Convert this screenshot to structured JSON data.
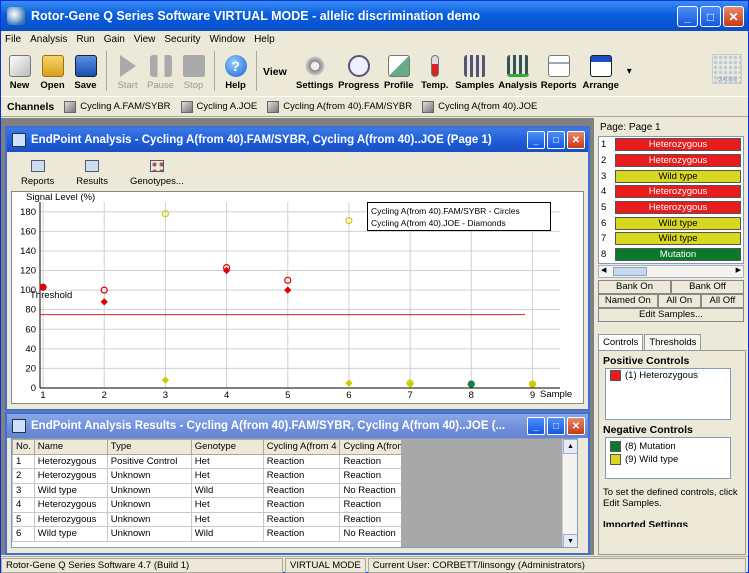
{
  "app": {
    "title": "Rotor-Gene Q Series Software VIRTUAL MODE - allelic discrimination demo"
  },
  "menu": [
    "File",
    "Analysis",
    "Run",
    "Gain",
    "View",
    "Security",
    "Window",
    "Help"
  ],
  "toolbar": {
    "left": [
      {
        "label": "New",
        "icon": "new-icon",
        "enabled": true
      },
      {
        "label": "Open",
        "icon": "open-folder-icon",
        "enabled": true
      },
      {
        "label": "Save",
        "icon": "save-disk-icon",
        "enabled": true
      },
      {
        "label": "Start",
        "icon": "play-icon",
        "enabled": false
      },
      {
        "label": "Pause",
        "icon": "pause-icon",
        "enabled": false
      },
      {
        "label": "Stop",
        "icon": "stop-icon",
        "enabled": false
      },
      {
        "label": "Help",
        "icon": "help-icon",
        "enabled": true
      }
    ],
    "view_label": "View",
    "view": [
      {
        "label": "Settings",
        "icon": "gears-icon"
      },
      {
        "label": "Progress",
        "icon": "stopwatch-icon"
      },
      {
        "label": "Profile",
        "icon": "profile-chart-icon"
      },
      {
        "label": "Temp.",
        "icon": "thermometer-icon"
      },
      {
        "label": "Samples",
        "icon": "samples-icon"
      },
      {
        "label": "Analysis",
        "icon": "analysis-icon"
      },
      {
        "label": "Reports",
        "icon": "reports-icon"
      },
      {
        "label": "Arrange",
        "icon": "arrange-windows-icon"
      }
    ],
    "brand": "QIAGEN"
  },
  "channels": {
    "label": "Channels",
    "items": [
      "Cycling A.FAM/SYBR",
      "Cycling A.JOE",
      "Cycling A(from 40).FAM/SYBR",
      "Cycling A(from 40).JOE"
    ]
  },
  "endpoint_window": {
    "title": "EndPoint Analysis - Cycling A(from 40).FAM/SYBR, Cycling A(from 40)..JOE (Page 1)",
    "tools": [
      "Reports",
      "Results",
      "Genotypes..."
    ],
    "legend": [
      "Cycling A(from 40).FAM/SYBR - Circles",
      "Cycling A(from 40).JOE - Diamonds"
    ],
    "threshold_label": "Threshold"
  },
  "chart_data": {
    "type": "scatter",
    "ylabel": "Signal Level (%)",
    "xlabel": "Sample",
    "x_ticks": [
      1,
      2,
      3,
      4,
      5,
      6,
      7,
      8,
      9
    ],
    "y_ticks": [
      0,
      20,
      40,
      60,
      80,
      100,
      120,
      140,
      160,
      180
    ],
    "xlim": [
      0.95,
      9.45
    ],
    "ylim": [
      0,
      190
    ],
    "threshold": 75,
    "grid": true,
    "legend": "top-right",
    "series": [
      {
        "name": "Cycling A(from 40).FAM/SYBR - Circles",
        "shape": "circle",
        "points": [
          [
            1,
            103,
            "#e00000"
          ],
          [
            2,
            100,
            "#e00000"
          ],
          [
            3,
            178,
            "#cccc00"
          ],
          [
            4,
            123,
            "#e00000"
          ],
          [
            5,
            110,
            "#e00000"
          ],
          [
            6,
            171,
            "#cccc00"
          ],
          [
            7,
            5,
            "#cccc00"
          ],
          [
            8,
            4,
            "#108040"
          ],
          [
            9,
            4,
            "#cccc00"
          ]
        ]
      },
      {
        "name": "Cycling A(from 40).JOE - Diamonds",
        "shape": "diamond",
        "points": [
          [
            1,
            103,
            "#e00000"
          ],
          [
            2,
            88,
            "#e00000"
          ],
          [
            3,
            8,
            "#cccc00"
          ],
          [
            4,
            120,
            "#e00000"
          ],
          [
            5,
            100,
            "#e00000"
          ],
          [
            6,
            5,
            "#cccc00"
          ],
          [
            7,
            4,
            "#cccc00"
          ],
          [
            8,
            4,
            "#108040"
          ],
          [
            9,
            4,
            "#cccc00"
          ]
        ]
      }
    ]
  },
  "results_window": {
    "title": "EndPoint Analysis Results - Cycling A(from 40).FAM/SYBR, Cycling A(from 40)..JOE (...",
    "columns": [
      "No.",
      "Name",
      "Type",
      "Genotype",
      "Cycling A(from 4",
      "Cycling A(from 4"
    ],
    "rows": [
      [
        "1",
        "Heterozygous",
        "Positive Control",
        "Het",
        "Reaction",
        "Reaction"
      ],
      [
        "2",
        "Heterozygous",
        "Unknown",
        "Het",
        "Reaction",
        "Reaction"
      ],
      [
        "3",
        "Wild type",
        "Unknown",
        "Wild",
        "Reaction",
        "No Reaction"
      ],
      [
        "4",
        "Heterozygous",
        "Unknown",
        "Het",
        "Reaction",
        "Reaction"
      ],
      [
        "5",
        "Heterozygous",
        "Unknown",
        "Het",
        "Reaction",
        "Reaction"
      ],
      [
        "6",
        "Wild type",
        "Unknown",
        "Wild",
        "Reaction",
        "No Reaction"
      ]
    ]
  },
  "samples_panel": {
    "page_label": "Page: Page 1",
    "samples": [
      {
        "n": "1",
        "name": "Heterozygous",
        "color": "#e81c1c",
        "text": "#ffffff"
      },
      {
        "n": "2",
        "name": "Heterozygous",
        "color": "#e81c1c",
        "text": "#ffffff"
      },
      {
        "n": "3",
        "name": "Wild type",
        "color": "#d8d820",
        "text": "#000000"
      },
      {
        "n": "4",
        "name": "Heterozygous",
        "color": "#e81c1c",
        "text": "#ffffff"
      },
      {
        "n": "5",
        "name": "Heterozygous",
        "color": "#e81c1c",
        "text": "#ffffff"
      },
      {
        "n": "6",
        "name": "Wild type",
        "color": "#d8d820",
        "text": "#000000"
      },
      {
        "n": "7",
        "name": "Wild type",
        "color": "#d8d820",
        "text": "#000000"
      },
      {
        "n": "8",
        "name": "Mutation",
        "color": "#0a7a2a",
        "text": "#ffffff"
      }
    ],
    "bank_on": "Bank On",
    "bank_off": "Bank Off",
    "named_on": "Named On",
    "all_on": "All On",
    "all_off": "All Off",
    "edit_samples": "Edit Samples...",
    "tabs": [
      "Controls",
      "Thresholds"
    ],
    "positive_header": "Positive Controls",
    "positive": [
      {
        "label": "(1) Heterozygous",
        "color": "#e81c1c"
      }
    ],
    "negative_header": "Negative Controls",
    "negative": [
      {
        "label": "(8) Mutation",
        "color": "#0a7a2a"
      },
      {
        "label": "(9) Wild type",
        "color": "#d8d820"
      }
    ],
    "note": "To set the defined controls, click Edit Samples.",
    "imported": "Imported Settings"
  },
  "status": {
    "version": "Rotor-Gene Q Series Software 4.7 (Build 1)",
    "mode": "VIRTUAL MODE",
    "user": "Current User: CORBETT/linsongy (Administrators)"
  }
}
